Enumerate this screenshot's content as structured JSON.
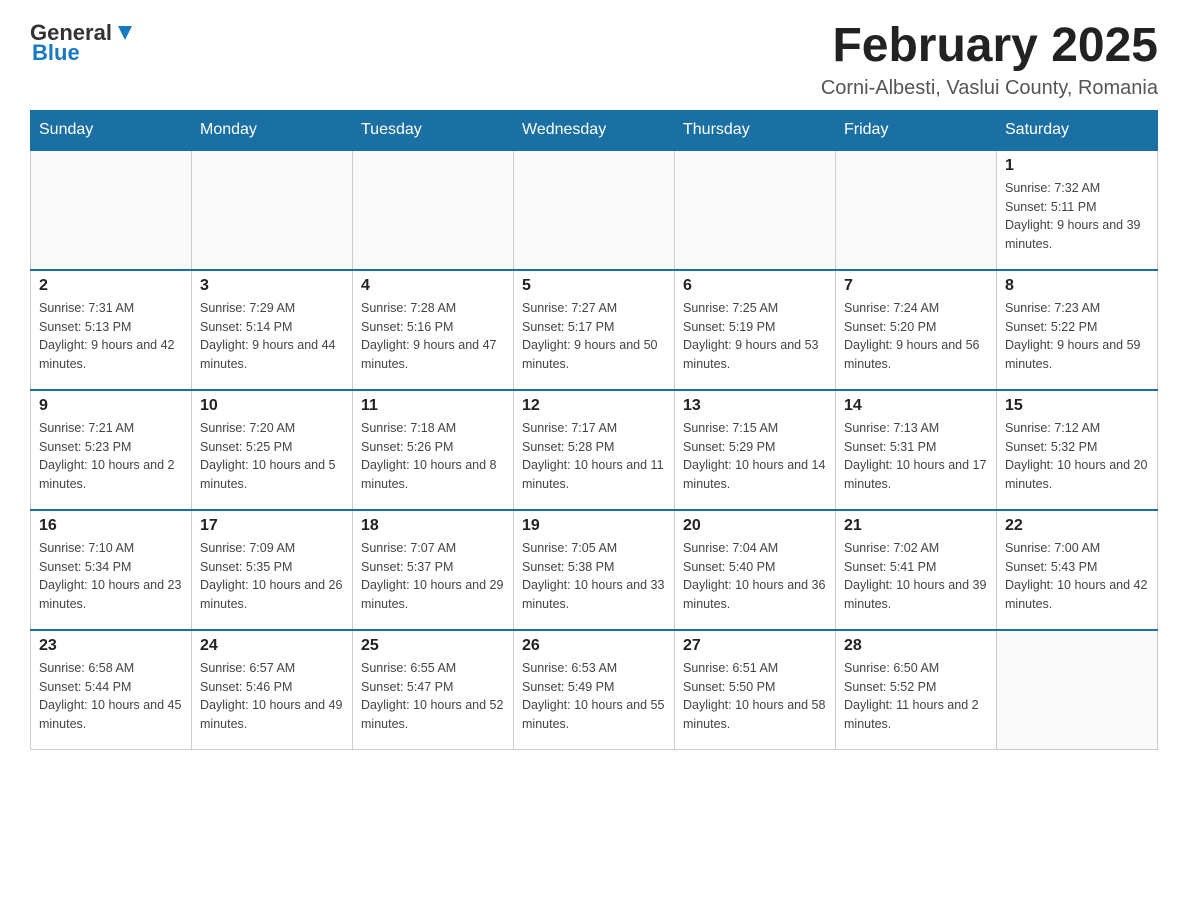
{
  "logo": {
    "text_general": "General",
    "text_blue": "Blue"
  },
  "header": {
    "month_title": "February 2025",
    "location": "Corni-Albesti, Vaslui County, Romania"
  },
  "weekdays": [
    "Sunday",
    "Monday",
    "Tuesday",
    "Wednesday",
    "Thursday",
    "Friday",
    "Saturday"
  ],
  "weeks": [
    [
      {
        "day": "",
        "info": ""
      },
      {
        "day": "",
        "info": ""
      },
      {
        "day": "",
        "info": ""
      },
      {
        "day": "",
        "info": ""
      },
      {
        "day": "",
        "info": ""
      },
      {
        "day": "",
        "info": ""
      },
      {
        "day": "1",
        "info": "Sunrise: 7:32 AM\nSunset: 5:11 PM\nDaylight: 9 hours and 39 minutes."
      }
    ],
    [
      {
        "day": "2",
        "info": "Sunrise: 7:31 AM\nSunset: 5:13 PM\nDaylight: 9 hours and 42 minutes."
      },
      {
        "day": "3",
        "info": "Sunrise: 7:29 AM\nSunset: 5:14 PM\nDaylight: 9 hours and 44 minutes."
      },
      {
        "day": "4",
        "info": "Sunrise: 7:28 AM\nSunset: 5:16 PM\nDaylight: 9 hours and 47 minutes."
      },
      {
        "day": "5",
        "info": "Sunrise: 7:27 AM\nSunset: 5:17 PM\nDaylight: 9 hours and 50 minutes."
      },
      {
        "day": "6",
        "info": "Sunrise: 7:25 AM\nSunset: 5:19 PM\nDaylight: 9 hours and 53 minutes."
      },
      {
        "day": "7",
        "info": "Sunrise: 7:24 AM\nSunset: 5:20 PM\nDaylight: 9 hours and 56 minutes."
      },
      {
        "day": "8",
        "info": "Sunrise: 7:23 AM\nSunset: 5:22 PM\nDaylight: 9 hours and 59 minutes."
      }
    ],
    [
      {
        "day": "9",
        "info": "Sunrise: 7:21 AM\nSunset: 5:23 PM\nDaylight: 10 hours and 2 minutes."
      },
      {
        "day": "10",
        "info": "Sunrise: 7:20 AM\nSunset: 5:25 PM\nDaylight: 10 hours and 5 minutes."
      },
      {
        "day": "11",
        "info": "Sunrise: 7:18 AM\nSunset: 5:26 PM\nDaylight: 10 hours and 8 minutes."
      },
      {
        "day": "12",
        "info": "Sunrise: 7:17 AM\nSunset: 5:28 PM\nDaylight: 10 hours and 11 minutes."
      },
      {
        "day": "13",
        "info": "Sunrise: 7:15 AM\nSunset: 5:29 PM\nDaylight: 10 hours and 14 minutes."
      },
      {
        "day": "14",
        "info": "Sunrise: 7:13 AM\nSunset: 5:31 PM\nDaylight: 10 hours and 17 minutes."
      },
      {
        "day": "15",
        "info": "Sunrise: 7:12 AM\nSunset: 5:32 PM\nDaylight: 10 hours and 20 minutes."
      }
    ],
    [
      {
        "day": "16",
        "info": "Sunrise: 7:10 AM\nSunset: 5:34 PM\nDaylight: 10 hours and 23 minutes."
      },
      {
        "day": "17",
        "info": "Sunrise: 7:09 AM\nSunset: 5:35 PM\nDaylight: 10 hours and 26 minutes."
      },
      {
        "day": "18",
        "info": "Sunrise: 7:07 AM\nSunset: 5:37 PM\nDaylight: 10 hours and 29 minutes."
      },
      {
        "day": "19",
        "info": "Sunrise: 7:05 AM\nSunset: 5:38 PM\nDaylight: 10 hours and 33 minutes."
      },
      {
        "day": "20",
        "info": "Sunrise: 7:04 AM\nSunset: 5:40 PM\nDaylight: 10 hours and 36 minutes."
      },
      {
        "day": "21",
        "info": "Sunrise: 7:02 AM\nSunset: 5:41 PM\nDaylight: 10 hours and 39 minutes."
      },
      {
        "day": "22",
        "info": "Sunrise: 7:00 AM\nSunset: 5:43 PM\nDaylight: 10 hours and 42 minutes."
      }
    ],
    [
      {
        "day": "23",
        "info": "Sunrise: 6:58 AM\nSunset: 5:44 PM\nDaylight: 10 hours and 45 minutes."
      },
      {
        "day": "24",
        "info": "Sunrise: 6:57 AM\nSunset: 5:46 PM\nDaylight: 10 hours and 49 minutes."
      },
      {
        "day": "25",
        "info": "Sunrise: 6:55 AM\nSunset: 5:47 PM\nDaylight: 10 hours and 52 minutes."
      },
      {
        "day": "26",
        "info": "Sunrise: 6:53 AM\nSunset: 5:49 PM\nDaylight: 10 hours and 55 minutes."
      },
      {
        "day": "27",
        "info": "Sunrise: 6:51 AM\nSunset: 5:50 PM\nDaylight: 10 hours and 58 minutes."
      },
      {
        "day": "28",
        "info": "Sunrise: 6:50 AM\nSunset: 5:52 PM\nDaylight: 11 hours and 2 minutes."
      },
      {
        "day": "",
        "info": ""
      }
    ]
  ]
}
